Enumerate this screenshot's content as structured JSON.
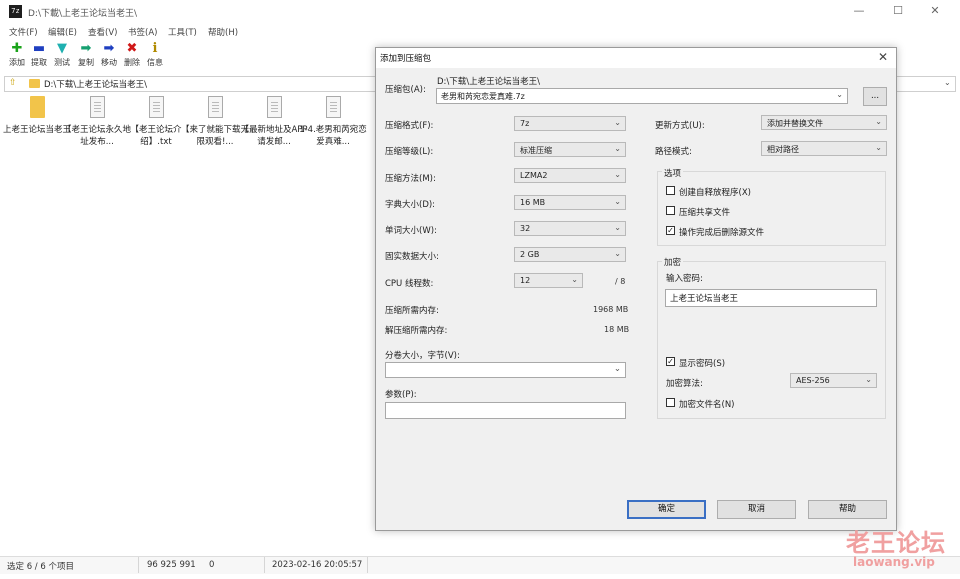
{
  "window": {
    "app_icon_text": "7z",
    "title": "D:\\下載\\上老王论坛当老王\\",
    "minimize": "—",
    "maximize": "☐",
    "close": "✕"
  },
  "menu": [
    "文件(F)",
    "编辑(E)",
    "查看(V)",
    "书签(A)",
    "工具(T)",
    "帮助(H)"
  ],
  "toolbar": [
    {
      "label": "添加",
      "icon": "plus-icon",
      "glyph": "✚",
      "color": "#1aa31a"
    },
    {
      "label": "提取",
      "icon": "minus-icon",
      "glyph": "▬",
      "color": "#1f3fc0"
    },
    {
      "label": "测试",
      "icon": "check-arrow-icon",
      "glyph": "▼",
      "color": "#1fb0b0"
    },
    {
      "label": "复制",
      "icon": "copy-arrow-icon",
      "glyph": "➡",
      "color": "#16a070"
    },
    {
      "label": "移动",
      "icon": "move-arrow-icon",
      "glyph": "➡",
      "color": "#1f3fc0"
    },
    {
      "label": "删除",
      "icon": "delete-icon",
      "glyph": "✖",
      "color": "#d01818"
    },
    {
      "label": "信息",
      "icon": "info-icon",
      "glyph": "i",
      "color": "#b08a00"
    }
  ],
  "address": "D:\\下载\\上老王论坛当老王\\",
  "files": [
    {
      "name": "上老王论坛当老王",
      "type": "folder"
    },
    {
      "name": "【老王论坛永久地址发布...",
      "type": "doc"
    },
    {
      "name": "【老王论坛介绍】.txt",
      "type": "doc"
    },
    {
      "name": "【来了就能下载无限观看!...",
      "type": "doc"
    },
    {
      "name": "【最新地址及APP请发邮...",
      "type": "doc"
    },
    {
      "name": "1-4.老男和芮宛恋爱真难...",
      "type": "doc"
    }
  ],
  "status": {
    "selected": "选定 6 / 6 个项目",
    "size": "96 925 991",
    "packed": "0",
    "modified": "2023-02-16 20:05:57"
  },
  "dialog": {
    "title": "添加到压缩包",
    "archive_label": "压缩包(A):",
    "archive_path": "D:\\下载\\上老王论坛当老王\\",
    "archive_name": "老男和芮宛恋爱真难.7z",
    "browse": "...",
    "format_label": "压缩格式(F):",
    "format_value": "7z",
    "level_label": "压缩等级(L):",
    "level_value": "标准压缩",
    "method_label": "压缩方法(M):",
    "method_value": "LZMA2",
    "dict_label": "字典大小(D):",
    "dict_value": "16 MB",
    "word_label": "单词大小(W):",
    "word_value": "32",
    "solid_label": "固实数据大小:",
    "solid_value": "2 GB",
    "cpu_label": "CPU 线程数:",
    "cpu_value": "12",
    "cpu_max": "/ 8",
    "mem_comp_label": "压缩所需内存:",
    "mem_comp_value": "1968 MB",
    "mem_decomp_label": "解压缩所需内存:",
    "mem_decomp_value": "18 MB",
    "split_label": "分卷大小，字节(V):",
    "params_label": "参数(P):",
    "update_label": "更新方式(U):",
    "update_value": "添加并替换文件",
    "path_label": "路径模式:",
    "path_value": "相对路径",
    "options_title": "选项",
    "opt_sfx": "创建自释放程序(X)",
    "opt_shared": "压缩共享文件",
    "opt_delete": "操作完成后删除源文件",
    "encrypt_title": "加密",
    "password_label": "输入密码:",
    "password_value": "上老王论坛当老王",
    "show_password": "显示密码(S)",
    "enc_method_label": "加密算法:",
    "enc_method_value": "AES-256",
    "encrypt_names": "加密文件名(N)",
    "ok": "确定",
    "cancel": "取消",
    "help": "帮助"
  },
  "watermark": {
    "main": "老王论坛",
    "sub": "laowang.vip"
  }
}
